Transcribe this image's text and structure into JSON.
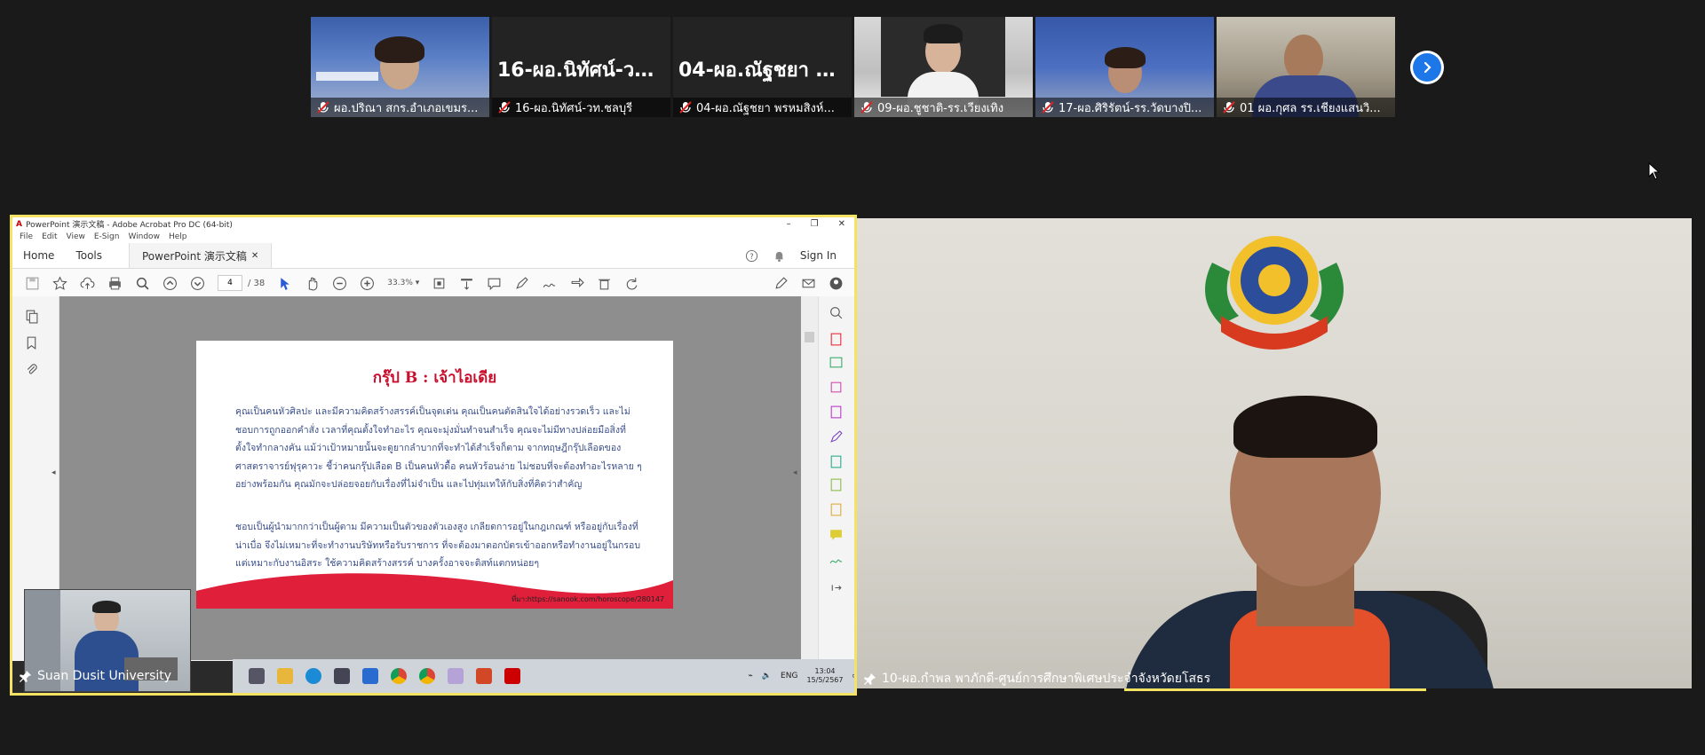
{
  "thumbnails": [
    {
      "label": "ผอ.ปริณา สกร.อำเภอเขมร...",
      "muted": true,
      "video": true
    },
    {
      "label": "16-ผอ.นิทัศน์-วท.ชลบุรี",
      "display_name": "16-ผอ.นิทัศน์-วท...",
      "muted": true,
      "video": false
    },
    {
      "label": "04-ผอ.ณัฐชยา พรหมสิงห์...",
      "display_name": "04-ผอ.ณัฐชยา พ...",
      "muted": true,
      "video": false
    },
    {
      "label": "09-ผอ.ชูชาติ-รร.เวียงเทิง",
      "muted": true,
      "video": true
    },
    {
      "label": "17-ผอ.ศิริรัตน์-รร.วัดบางปิ...",
      "muted": true,
      "video": true
    },
    {
      "label": "01 ผอ.กุศล รร.เชียงแสนวิ...",
      "muted": true,
      "video": true
    }
  ],
  "share": {
    "participant": "Suan Dusit University",
    "window_title": "PowerPoint 演示文稿 - Adobe Acrobat Pro DC (64-bit)",
    "menu": [
      "File",
      "Edit",
      "View",
      "E-Sign",
      "Window",
      "Help"
    ],
    "tabs": {
      "home": "Home",
      "tools": "Tools",
      "document": "PowerPoint 演示文稿"
    },
    "sign_in": "Sign In",
    "page_current": "4",
    "page_total": "/ 38",
    "zoom": "33.3%",
    "slide": {
      "title": "กรุ๊ป B : เจ้าไอเดีย",
      "para1": "คุณเป็นคนหัวศิลปะ และมีความคิดสร้างสรรค์เป็นจุดเด่น คุณเป็นคนตัดสินใจได้อย่างรวดเร็ว และไม่ชอบการถูกออกคำสั่ง เวลาที่คุณตั้งใจทำอะไร คุณจะมุ่งมั่นทำจนสำเร็จ คุณจะไม่มีทางปล่อยมือสิ่งที่ตั้งใจทำกลางคัน แม้ว่าเป้าหมายนั้นจะดูยากลำบากที่จะทำได้สำเร็จก็ตาม จากทฤษฎีกรุ๊ปเลือดของศาสตราจารย์ฟุรุคาวะ ชี้ว่าคนกรุ๊ปเลือด B เป็นคนหัวดื้อ คนหัวร้อนง่าย ไม่ชอบที่จะต้องทำอะไรหลาย ๆ อย่างพร้อมกัน คุณมักจะปล่อยจอยกับเรื่องที่ไม่จำเป็น และไปทุ่มเทให้กับสิ่งที่คิดว่าสำคัญ",
      "para2": "ชอบเป็นผู้นำมากกว่าเป็นผู้ตาม มีความเป็นตัวของตัวเองสูง เกลียดการอยู่ในกฎเกณฑ์ หรืออยู่กับเรื่องที่น่าเบื่อ จึงไม่เหมาะที่จะทำงานบริษัทหรือรับราชการ ที่จะต้องมาตอกบัตรเข้าออกหรือทำงานอยู่ในกรอบ แต่เหมาะกับงานอิสระ ใช้ความคิดสร้างสรรค์ บางครั้งอาจจะดิสท์แตกหน่อยๆ",
      "source": "ที่มา:https://sanook.com/horoscope/280147"
    },
    "taskbar": {
      "lang": "ENG",
      "time": "13:04",
      "date": "15/5/2567"
    }
  },
  "speaker": {
    "label": "10-ผอ.กำพล พาภักดี-ศูนย์การศึกษาพิเศษประจำจังหวัดยโสธร"
  },
  "colors": {
    "background": "#1a1a1a",
    "active_speaker_border": "#f4e363",
    "accent_blue": "#1e77e8",
    "muted_red": "#e02424"
  }
}
